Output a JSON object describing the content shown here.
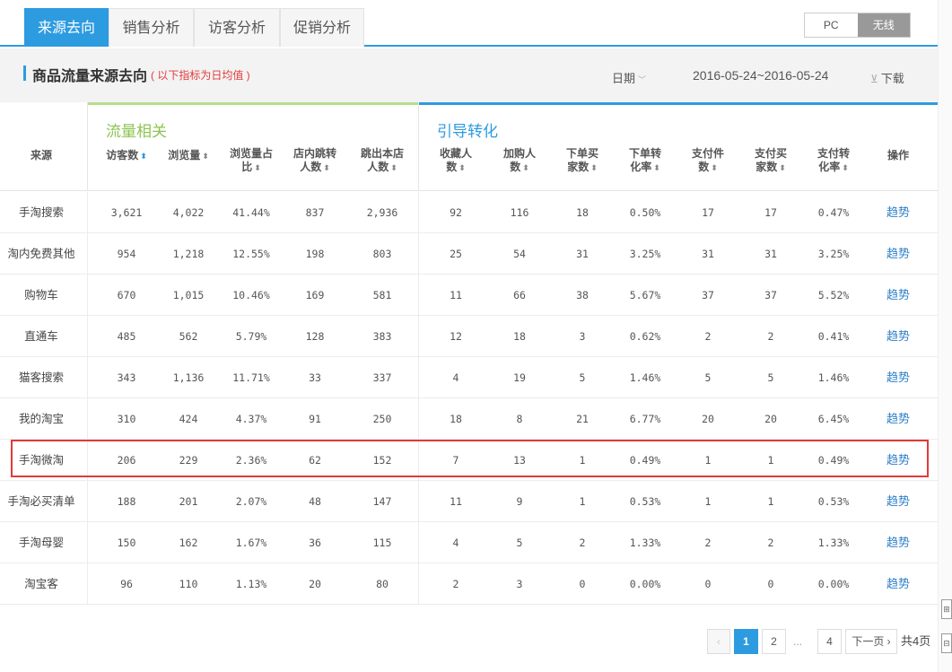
{
  "tabs": [
    {
      "label": "来源去向",
      "active": true
    },
    {
      "label": "销售分析",
      "active": false
    },
    {
      "label": "访客分析",
      "active": false
    },
    {
      "label": "促销分析",
      "active": false
    }
  ],
  "device_toggle": {
    "pc": "PC",
    "wireless": "无线",
    "selected": "无线"
  },
  "header": {
    "title": "商品流量来源去向",
    "subtitle": "( 以下指标为日均值 )",
    "date_label": "日期",
    "date_range": "2016-05-24~2016-05-24",
    "download": "下载"
  },
  "groups": {
    "traffic": "流量相关",
    "conversion": "引导转化"
  },
  "columns": [
    "来源",
    "访客数",
    "浏览量",
    "浏览量占比",
    "店内跳转人数",
    "跳出本店人数",
    "收藏人数",
    "加购人数",
    "下单买家数",
    "下单转化率",
    "支付件数",
    "支付买家数",
    "支付转化率",
    "操作"
  ],
  "column_lines": [
    [
      "来源"
    ],
    [
      "访客数"
    ],
    [
      "浏览量"
    ],
    [
      "浏览量占",
      "比"
    ],
    [
      "店内跳转",
      "人数"
    ],
    [
      "跳出本店",
      "人数"
    ],
    [
      "收藏人",
      "数"
    ],
    [
      "加购人",
      "数"
    ],
    [
      "下单买",
      "家数"
    ],
    [
      "下单转",
      "化率"
    ],
    [
      "支付件",
      "数"
    ],
    [
      "支付买",
      "家数"
    ],
    [
      "支付转",
      "化率"
    ],
    [
      "操作"
    ]
  ],
  "rows": [
    [
      "手淘搜索",
      "3,621",
      "4,022",
      "41.44%",
      "837",
      "2,936",
      "92",
      "116",
      "18",
      "0.50%",
      "17",
      "17",
      "0.47%",
      "趋势"
    ],
    [
      "淘内免费其他",
      "954",
      "1,218",
      "12.55%",
      "198",
      "803",
      "25",
      "54",
      "31",
      "3.25%",
      "31",
      "31",
      "3.25%",
      "趋势"
    ],
    [
      "购物车",
      "670",
      "1,015",
      "10.46%",
      "169",
      "581",
      "11",
      "66",
      "38",
      "5.67%",
      "37",
      "37",
      "5.52%",
      "趋势"
    ],
    [
      "直通车",
      "485",
      "562",
      "5.79%",
      "128",
      "383",
      "12",
      "18",
      "3",
      "0.62%",
      "2",
      "2",
      "0.41%",
      "趋势"
    ],
    [
      "猫客搜索",
      "343",
      "1,136",
      "11.71%",
      "33",
      "337",
      "4",
      "19",
      "5",
      "1.46%",
      "5",
      "5",
      "1.46%",
      "趋势"
    ],
    [
      "我的淘宝",
      "310",
      "424",
      "4.37%",
      "91",
      "250",
      "18",
      "8",
      "21",
      "6.77%",
      "20",
      "20",
      "6.45%",
      "趋势"
    ],
    [
      "手淘微淘",
      "206",
      "229",
      "2.36%",
      "62",
      "152",
      "7",
      "13",
      "1",
      "0.49%",
      "1",
      "1",
      "0.49%",
      "趋势"
    ],
    [
      "手淘必买清单",
      "188",
      "201",
      "2.07%",
      "48",
      "147",
      "11",
      "9",
      "1",
      "0.53%",
      "1",
      "1",
      "0.53%",
      "趋势"
    ],
    [
      "手淘母婴",
      "150",
      "162",
      "1.67%",
      "36",
      "115",
      "4",
      "5",
      "2",
      "1.33%",
      "2",
      "2",
      "1.33%",
      "趋势"
    ],
    [
      "淘宝客",
      "96",
      "110",
      "1.13%",
      "20",
      "80",
      "2",
      "3",
      "0",
      "0.00%",
      "0",
      "0",
      "0.00%",
      "趋势"
    ]
  ],
  "highlighted_row": "手淘微淘",
  "pagination": {
    "prev": "‹",
    "pages": [
      "1",
      "2",
      "...",
      "4"
    ],
    "current": "1",
    "next": "下一页",
    "total": "共4页"
  },
  "colors": {
    "accent": "#2d9be0",
    "traffic_group": "#8cc451",
    "highlight": "#e23a3a",
    "link": "#2d7fc7"
  }
}
